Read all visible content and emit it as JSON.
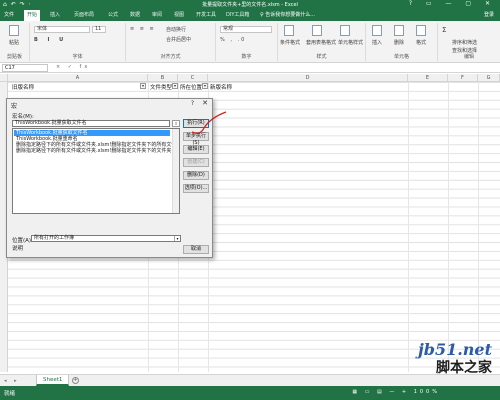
{
  "titlebar": {
    "title": "批量提取文件夹+里的文件名.xlsm - Excel",
    "qat": "⌂ ↶ ↷ ⋅",
    "window_controls": "? ▭ — ▢ ✕"
  },
  "menubar": {
    "tabs": [
      "文件",
      "开始",
      "插入",
      "页面布局",
      "公式",
      "数据",
      "审阅",
      "视图",
      "开发工具",
      "DIY工具箱"
    ],
    "tell_me": "♀ 告诉我你想要做什么...",
    "login": "登录"
  },
  "ribbon": {
    "clipboard": {
      "paste": "粘贴",
      "label": "剪贴板"
    },
    "font": {
      "name": "宋体",
      "size": "11",
      "label": "字体"
    },
    "alignment": {
      "wrap": "自动换行",
      "merge": "合并后居中",
      "label": "对齐方式"
    },
    "number": {
      "format": "常规",
      "label": "数字"
    },
    "styles": {
      "cond": "条件格式",
      "table": "套用表格格式",
      "cell": "单元格样式",
      "label": "样式"
    },
    "cells": {
      "insert": "插入",
      "delete": "删除",
      "format": "格式",
      "label": "单元格"
    },
    "editing": {
      "sum": "Σ",
      "sort": "排序和筛选",
      "find": "查找和选择",
      "label": "编辑"
    }
  },
  "formula_bar": {
    "name_box": "C17",
    "fx": "× ✓ fx"
  },
  "columns": [
    "A",
    "B",
    "C",
    "D",
    "E",
    "F",
    "G"
  ],
  "header_row": {
    "col_a": "旧版名称",
    "col_b": "文件类型",
    "col_c": "所在位置",
    "col_d": "新版名称",
    "dropdown": "▾"
  },
  "dialog": {
    "title": "宏",
    "help": "?",
    "close": "✕",
    "macro_name_label": "宏名(M):",
    "macro_name_value": "ThisWorkbook.批量获取文件名",
    "up_button": "⇧",
    "macros": [
      "ThisWorkbook.批量获取文件名",
      "ThisWorkbook.批量重命名",
      "删除指定路径下的所有文件或文件夹.xlsm!删除指定文件夹下的所有文件",
      "删除指定路径下的所有文件或文件夹.xlsm!删除指定文件夹下的文件夹"
    ],
    "selected_index": 0,
    "buttons": {
      "run": "执行(R)",
      "step": "单步执行(S)",
      "edit": "编辑(E)",
      "create": "创建(C)",
      "delete": "删除(D)",
      "options": "选项(O)...",
      "cancel": "取消"
    },
    "location_label": "位置(A):",
    "location_value": "所有打开的工作簿",
    "location_arrow": "▾",
    "description_label": "说明"
  },
  "sheet_bar": {
    "nav": "◂ ▸",
    "sheet_name": "Sheet1",
    "add": "+"
  },
  "status_bar": {
    "status": "就绪",
    "view": "▦ ▭ ▤ — + 100%"
  },
  "watermark": {
    "site": "jb51.net",
    "name": "脚本之家"
  },
  "colors": {
    "excel_green": "#217346",
    "selection_blue": "#3399ff"
  }
}
